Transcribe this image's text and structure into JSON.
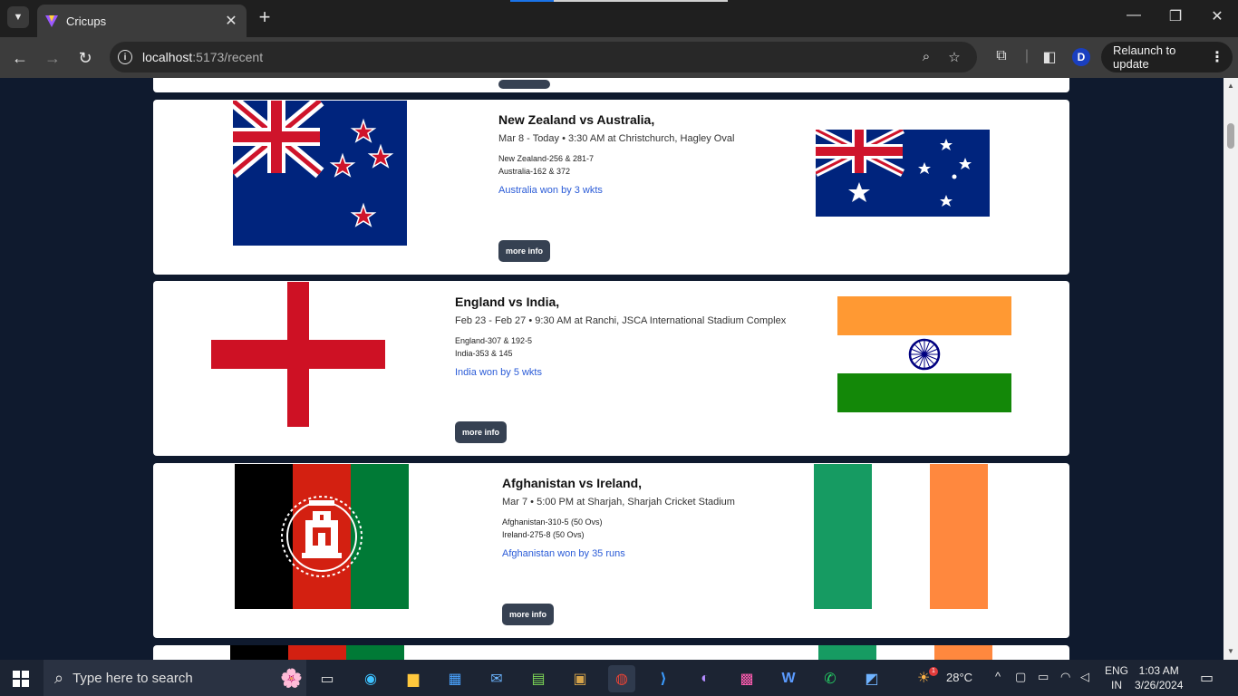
{
  "browser": {
    "tab_title": "Cricups",
    "url_host": "localhost",
    "url_path": ":5173/recent",
    "relaunch_label": "Relaunch to update",
    "profile_initial": "D"
  },
  "matches": [
    {
      "title": "New Zealand vs Australia,",
      "meta": "Mar 8 - Today • 3:30 AM at Christchurch, Hagley Oval",
      "score1": "New Zealand-256 & 281-7",
      "score2": "Australia-162 & 372",
      "result": "Australia won by 3 wkts",
      "button": "more info",
      "flag_left": "new-zealand",
      "flag_right": "australia"
    },
    {
      "title": "England vs India,",
      "meta": "Feb 23 - Feb 27 • 9:30 AM at Ranchi, JSCA International Stadium Complex",
      "score1": "England-307 & 192-5",
      "score2": "India-353 & 145",
      "result": "India won by 5 wkts",
      "button": "more info",
      "flag_left": "england",
      "flag_right": "india"
    },
    {
      "title": "Afghanistan vs Ireland,",
      "meta": "Mar 7 • 5:00 PM at Sharjah, Sharjah Cricket Stadium",
      "score1": "Afghanistan-310-5 (50 Ovs)",
      "score2": "Ireland-275-8 (50 Ovs)",
      "result": "Afghanistan won by 35 runs",
      "button": "more info",
      "flag_left": "afghanistan",
      "flag_right": "ireland"
    }
  ],
  "taskbar": {
    "search_placeholder": "Type here to search",
    "weather": "28°C",
    "language": "ENG",
    "region": "IN",
    "time": "1:03 AM",
    "date": "3/26/2024",
    "notification_count": "1"
  },
  "colors": {
    "accent_link": "#2a5bd7",
    "button_bg": "#364152",
    "page_bg": "#0f1a2e"
  }
}
